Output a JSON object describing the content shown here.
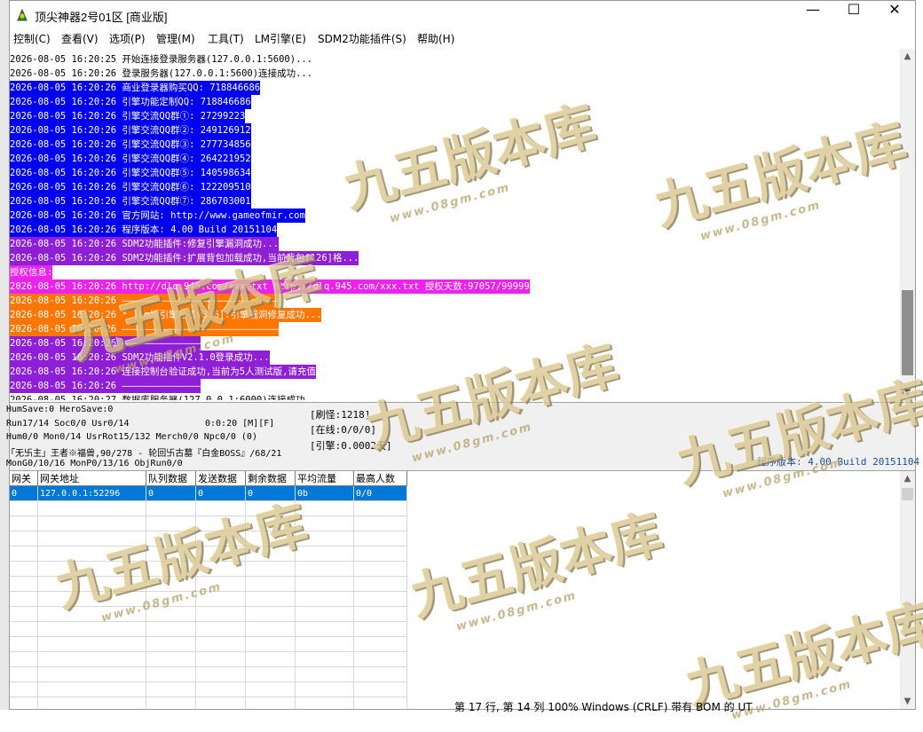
{
  "window": {
    "title": "顶尖神器2号01区 [商业版]",
    "minimize": "—",
    "maximize": "☐",
    "close": "✕"
  },
  "menu": [
    "控制(C)",
    "查看(V)",
    "选项(P)",
    "管理(M)",
    "工具(T)",
    "LM引擎(E)",
    "SDM2功能插件(S)",
    "帮助(H)"
  ],
  "log": [
    {
      "text": "2026-08-05 16:20:25 开始连接登录服务器(127.0.0.1:5600)...",
      "bg": "#ffffff",
      "fg": "#000000"
    },
    {
      "text": "2026-08-05 16:20:26 登录服务器(127.0.0.1:5600)连接成功...",
      "bg": "#ffffff",
      "fg": "#000000"
    },
    {
      "text": "2026-08-05 16:20:26 商业登录器购买QQ: 718846686",
      "bg": "#0000ee",
      "fg": "#ffffff"
    },
    {
      "text": "2026-08-05 16:20:26 引擎功能定制QQ: 718846686",
      "bg": "#0000ee",
      "fg": "#ffffff"
    },
    {
      "text": "2026-08-05 16:20:26 引擎交流QQ群①: 27299223",
      "bg": "#0000ee",
      "fg": "#ffffff"
    },
    {
      "text": "2026-08-05 16:20:26 引擎交流QQ群②: 249126912",
      "bg": "#0000ee",
      "fg": "#ffffff"
    },
    {
      "text": "2026-08-05 16:20:26 引擎交流QQ群③: 277734856",
      "bg": "#0000ee",
      "fg": "#ffffff"
    },
    {
      "text": "2026-08-05 16:20:26 引擎交流QQ群④: 264221952",
      "bg": "#0000ee",
      "fg": "#ffffff"
    },
    {
      "text": "2026-08-05 16:20:26 引擎交流QQ群⑤: 140598634",
      "bg": "#0000ee",
      "fg": "#ffffff"
    },
    {
      "text": "2026-08-05 16:20:26 引擎交流QQ群⑥: 122209510",
      "bg": "#0000ee",
      "fg": "#ffffff"
    },
    {
      "text": "2026-08-05 16:20:26 引擎交流QQ群⑦: 286703001",
      "bg": "#0000ee",
      "fg": "#ffffff"
    },
    {
      "text": "2026-08-05 16:20:26 官方网站: http://www.gameofmir.com",
      "bg": "#0000ee",
      "fg": "#ffffff"
    },
    {
      "text": "2026-08-05 16:20:26 程序版本: 4.00 Build 20151104",
      "bg": "#0000ee",
      "fg": "#ffffff"
    },
    {
      "text": "2026-08-05 16:20:26 SDM2功能插件:修复引擎漏洞成功...",
      "bg": "#8e1fd6",
      "fg": "#ffffff"
    },
    {
      "text": "2026-08-05 16:20:26 SDM2功能插件:扩展背包加载成功,当前背包[126]格...",
      "bg": "#8e1fd6",
      "fg": "#ffffff"
    },
    {
      "text": "授权信息:",
      "bg": "#ee22ee",
      "fg": "#ffffff"
    },
    {
      "text": "2026-08-05 16:20:26 http://dlq.945.com/xxx.txt http://dlq.945.com/xxx.txt 授权天数:97057/99999",
      "bg": "#ee22ee",
      "fg": "#ffffff"
    },
    {
      "text": "2026-08-05 16:20:26 ————————————————————————————",
      "bg": "#ff7700",
      "fg": "#ffffff"
    },
    {
      "text": "2026-08-05 16:20:26 * [Lm版引擎补丁v3.6]:引擎漏洞修复成功...",
      "bg": "#ff7700",
      "fg": "#ffffff"
    },
    {
      "text": "2026-08-05 16:20:26 ————————————————————————————",
      "bg": "#ff7700",
      "fg": "#ffffff"
    },
    {
      "text": "2026-08-05 16:20:26 ——————————————",
      "bg": "#8e1fd6",
      "fg": "#ffffff"
    },
    {
      "text": "2026-08-05 16:20:26 SDM2功能插件V2.1.0登录成功...",
      "bg": "#8e1fd6",
      "fg": "#ffffff"
    },
    {
      "text": "2026-08-05 16:20:26 连接控制台验证成功,当前为5人测试版,请充值",
      "bg": "#8e1fd6",
      "fg": "#ffffff"
    },
    {
      "text": "2026-08-05 16:20:26 ——————————————",
      "bg": "#8e1fd6",
      "fg": "#ffffff"
    },
    {
      "text": "2026-08-05 16:20:27 数据库服务器(127.0.0.1:6000)连接成功...",
      "bg": "#ffffff",
      "fg": "#000000"
    }
  ],
  "status": {
    "line1": "HumSave:0 HeroSave:0",
    "line2": "Run17/14 Soc0/0 Usr0/14",
    "line2b": "0:0:20 [M][F]",
    "line3": "Hum0/0 Mon0/14 UsrRot15/132 Merch0/0 Npc0/0 (0)",
    "line4": "「无卐主」王者※福兽,90/278 - 轮回卐古墓『白金BOSS』/68/21",
    "line5": "MonG0/10/16 MonP0/13/16 ObjRun0/0",
    "refresh": "[刷怪:1218]",
    "online": "[在线:0/0/0]",
    "engine": "[引擎:0.0002天]",
    "version": "程序版本: 4.00 Build 20151104"
  },
  "grid": {
    "headers": [
      "网关",
      "网关地址",
      "队列数据",
      "发送数据",
      "剩余数据",
      "平均流量",
      "最高人数"
    ],
    "rows": [
      [
        "0",
        "127.0.0.1:52296",
        "0",
        "0",
        "0",
        "0b",
        "0/0"
      ]
    ]
  },
  "watermark": {
    "text": "九五版本库",
    "url": "www.08gm.com"
  },
  "taskbar": "第 17 行, 第 14 列      100%      Windows (CRLF)      带有 BOM 的 UT"
}
